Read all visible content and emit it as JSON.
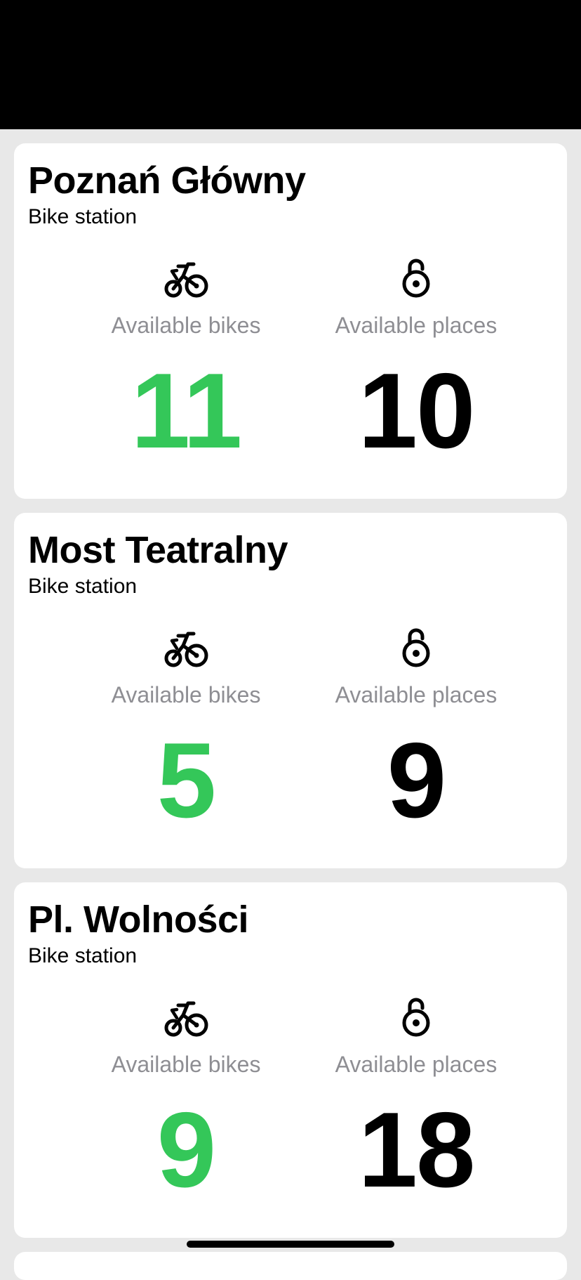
{
  "colors": {
    "available_bikes_value": "#34c759",
    "available_places_value": "#000000",
    "label_gray": "#8e8e93",
    "background": "#e8e8e8"
  },
  "icons": {
    "bikes": "bicycle-icon",
    "places": "lock-open-icon"
  },
  "stations": [
    {
      "name": "Poznań Główny",
      "type": "Bike station",
      "bikes_label": "Available bikes",
      "places_label": "Available places",
      "bikes": "11",
      "places": "10"
    },
    {
      "name": "Most Teatralny",
      "type": "Bike station",
      "bikes_label": "Available bikes",
      "places_label": "Available places",
      "bikes": "5",
      "places": "9"
    },
    {
      "name": "Pl. Wolności",
      "type": "Bike station",
      "bikes_label": "Available bikes",
      "places_label": "Available places",
      "bikes": "9",
      "places": "18"
    }
  ]
}
